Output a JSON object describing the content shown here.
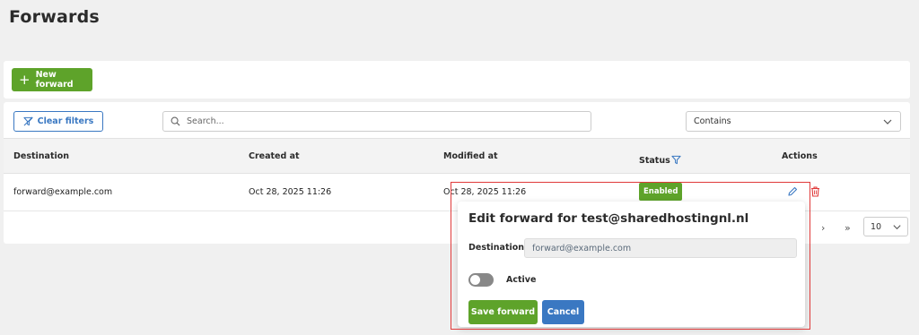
{
  "page": {
    "title": "Forwards"
  },
  "toolbar": {
    "new_forward_label": "New forward"
  },
  "filters": {
    "clear_label": "Clear filters",
    "search_placeholder": "Search...",
    "match_mode": "Contains"
  },
  "table": {
    "headers": {
      "destination": "Destination",
      "created": "Created at",
      "modified": "Modified at",
      "status": "Status",
      "actions": "Actions"
    },
    "rows": [
      {
        "destination": "forward@example.com",
        "created": "Oct 28, 2025 11:26",
        "modified": "Oct 28, 2025 11:26",
        "status": "Enabled"
      }
    ]
  },
  "pagination": {
    "next_label": "›",
    "last_label": "»",
    "page_size": "10"
  },
  "edit_popup": {
    "title": "Edit forward for test@sharedhostingnl.nl",
    "destination_label": "Destination::",
    "destination_value": "forward@example.com",
    "active_label": "Active",
    "active": false,
    "save_label": "Save forward",
    "cancel_label": "Cancel"
  },
  "colors": {
    "accent_green": "#5ea32a",
    "accent_blue": "#3a78c2",
    "delete_red": "#e03a3a",
    "highlight_outline": "#e03a3a"
  }
}
